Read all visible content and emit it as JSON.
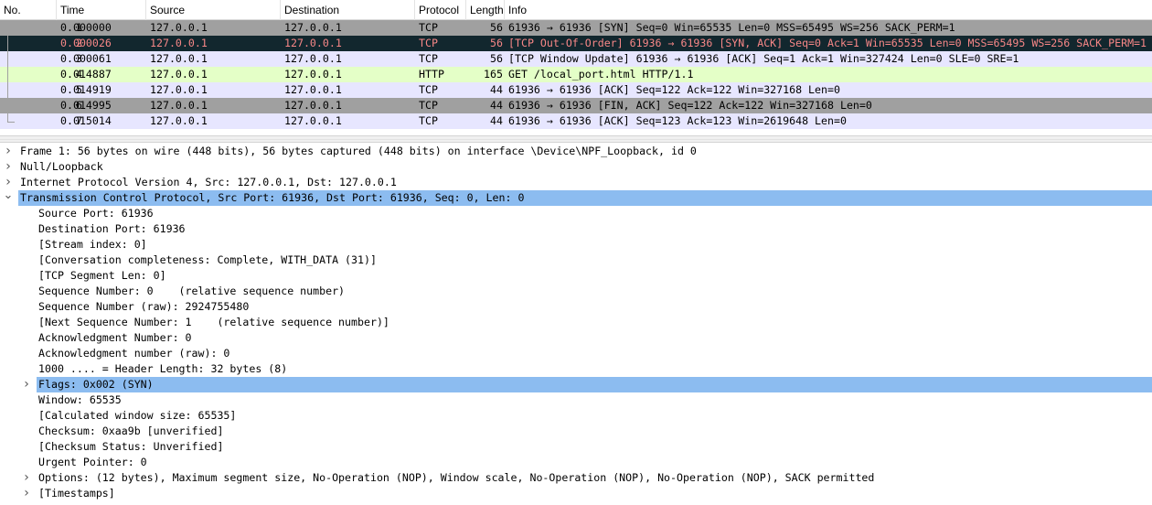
{
  "colors": {
    "syn": "#a0a0a0",
    "selected": "#12272e",
    "selected_text": "#f78787",
    "window_update": "#e7e6ff",
    "http": "#e4ffc7",
    "ack": "#e7e6ff",
    "fin": "#a0a0a0",
    "details_highlight": "#8cbcf0"
  },
  "packet_list": {
    "headers": {
      "no": "No.",
      "time": "Time",
      "source": "Source",
      "destination": "Destination",
      "protocol": "Protocol",
      "length": "Length",
      "info": "Info"
    },
    "rows": [
      {
        "no": "1",
        "time": "0.000000",
        "source": "127.0.0.1",
        "destination": "127.0.0.1",
        "protocol": "TCP",
        "length": "56",
        "info": "61936 → 61936 [SYN] Seq=0 Win=65535 Len=0 MSS=65495 WS=256 SACK_PERM=1",
        "style": "syn"
      },
      {
        "no": "2",
        "time": "0.000026",
        "source": "127.0.0.1",
        "destination": "127.0.0.1",
        "protocol": "TCP",
        "length": "56",
        "info": "[TCP Out-Of-Order] 61936 → 61936 [SYN, ACK] Seq=0 Ack=1 Win=65535 Len=0 MSS=65495 WS=256 SACK_PERM=1",
        "style": "selected"
      },
      {
        "no": "3",
        "time": "0.000061",
        "source": "127.0.0.1",
        "destination": "127.0.0.1",
        "protocol": "TCP",
        "length": "56",
        "info": "[TCP Window Update] 61936 → 61936 [ACK] Seq=1 Ack=1 Win=327424 Len=0 SLE=0 SRE=1",
        "style": "window_update"
      },
      {
        "no": "4",
        "time": "0.014887",
        "source": "127.0.0.1",
        "destination": "127.0.0.1",
        "protocol": "HTTP",
        "length": "165",
        "info": "GET /local_port.html HTTP/1.1",
        "style": "http"
      },
      {
        "no": "5",
        "time": "0.014919",
        "source": "127.0.0.1",
        "destination": "127.0.0.1",
        "protocol": "TCP",
        "length": "44",
        "info": "61936 → 61936 [ACK] Seq=122 Ack=122 Win=327168 Len=0",
        "style": "ack"
      },
      {
        "no": "6",
        "time": "0.014995",
        "source": "127.0.0.1",
        "destination": "127.0.0.1",
        "protocol": "TCP",
        "length": "44",
        "info": "61936 → 61936 [FIN, ACK] Seq=122 Ack=122 Win=327168 Len=0",
        "style": "fin"
      },
      {
        "no": "7",
        "time": "0.015014",
        "source": "127.0.0.1",
        "destination": "127.0.0.1",
        "protocol": "TCP",
        "length": "44",
        "info": "61936 → 61936 [ACK] Seq=123 Ack=123 Win=2619648 Len=0",
        "style": "ack"
      }
    ]
  },
  "details": [
    {
      "text": "Frame 1: 56 bytes on wire (448 bits), 56 bytes captured (448 bits) on interface \\Device\\NPF_Loopback, id 0",
      "level": 0,
      "expander": "collapsed"
    },
    {
      "text": "Null/Loopback",
      "level": 0,
      "expander": "collapsed"
    },
    {
      "text": "Internet Protocol Version 4, Src: 127.0.0.1, Dst: 127.0.0.1",
      "level": 0,
      "expander": "collapsed"
    },
    {
      "text": "Transmission Control Protocol, Src Port: 61936, Dst Port: 61936, Seq: 0, Len: 0",
      "level": 0,
      "expander": "expanded",
      "highlight": true
    },
    {
      "text": "Source Port: 61936",
      "level": 1
    },
    {
      "text": "Destination Port: 61936",
      "level": 1
    },
    {
      "text": "[Stream index: 0]",
      "level": 1
    },
    {
      "text": "[Conversation completeness: Complete, WITH_DATA (31)]",
      "level": 1
    },
    {
      "text": "[TCP Segment Len: 0]",
      "level": 1
    },
    {
      "text": "Sequence Number: 0    (relative sequence number)",
      "level": 1
    },
    {
      "text": "Sequence Number (raw): 2924755480",
      "level": 1
    },
    {
      "text": "[Next Sequence Number: 1    (relative sequence number)]",
      "level": 1
    },
    {
      "text": "Acknowledgment Number: 0",
      "level": 1
    },
    {
      "text": "Acknowledgment number (raw): 0",
      "level": 1
    },
    {
      "text": "1000 .... = Header Length: 32 bytes (8)",
      "level": 1
    },
    {
      "text": "Flags: 0x002 (SYN)",
      "level": 1,
      "expander": "collapsed",
      "highlight": true
    },
    {
      "text": "Window: 65535",
      "level": 1
    },
    {
      "text": "[Calculated window size: 65535]",
      "level": 1
    },
    {
      "text": "Checksum: 0xaa9b [unverified]",
      "level": 1
    },
    {
      "text": "[Checksum Status: Unverified]",
      "level": 1
    },
    {
      "text": "Urgent Pointer: 0",
      "level": 1
    },
    {
      "text": "Options: (12 bytes), Maximum segment size, No-Operation (NOP), Window scale, No-Operation (NOP), No-Operation (NOP), SACK permitted",
      "level": 1,
      "expander": "collapsed"
    },
    {
      "text": "[Timestamps]",
      "level": 1,
      "expander": "collapsed"
    }
  ],
  "icons": {
    "collapsed": "chevron-right-icon",
    "expanded": "chevron-down-icon"
  }
}
